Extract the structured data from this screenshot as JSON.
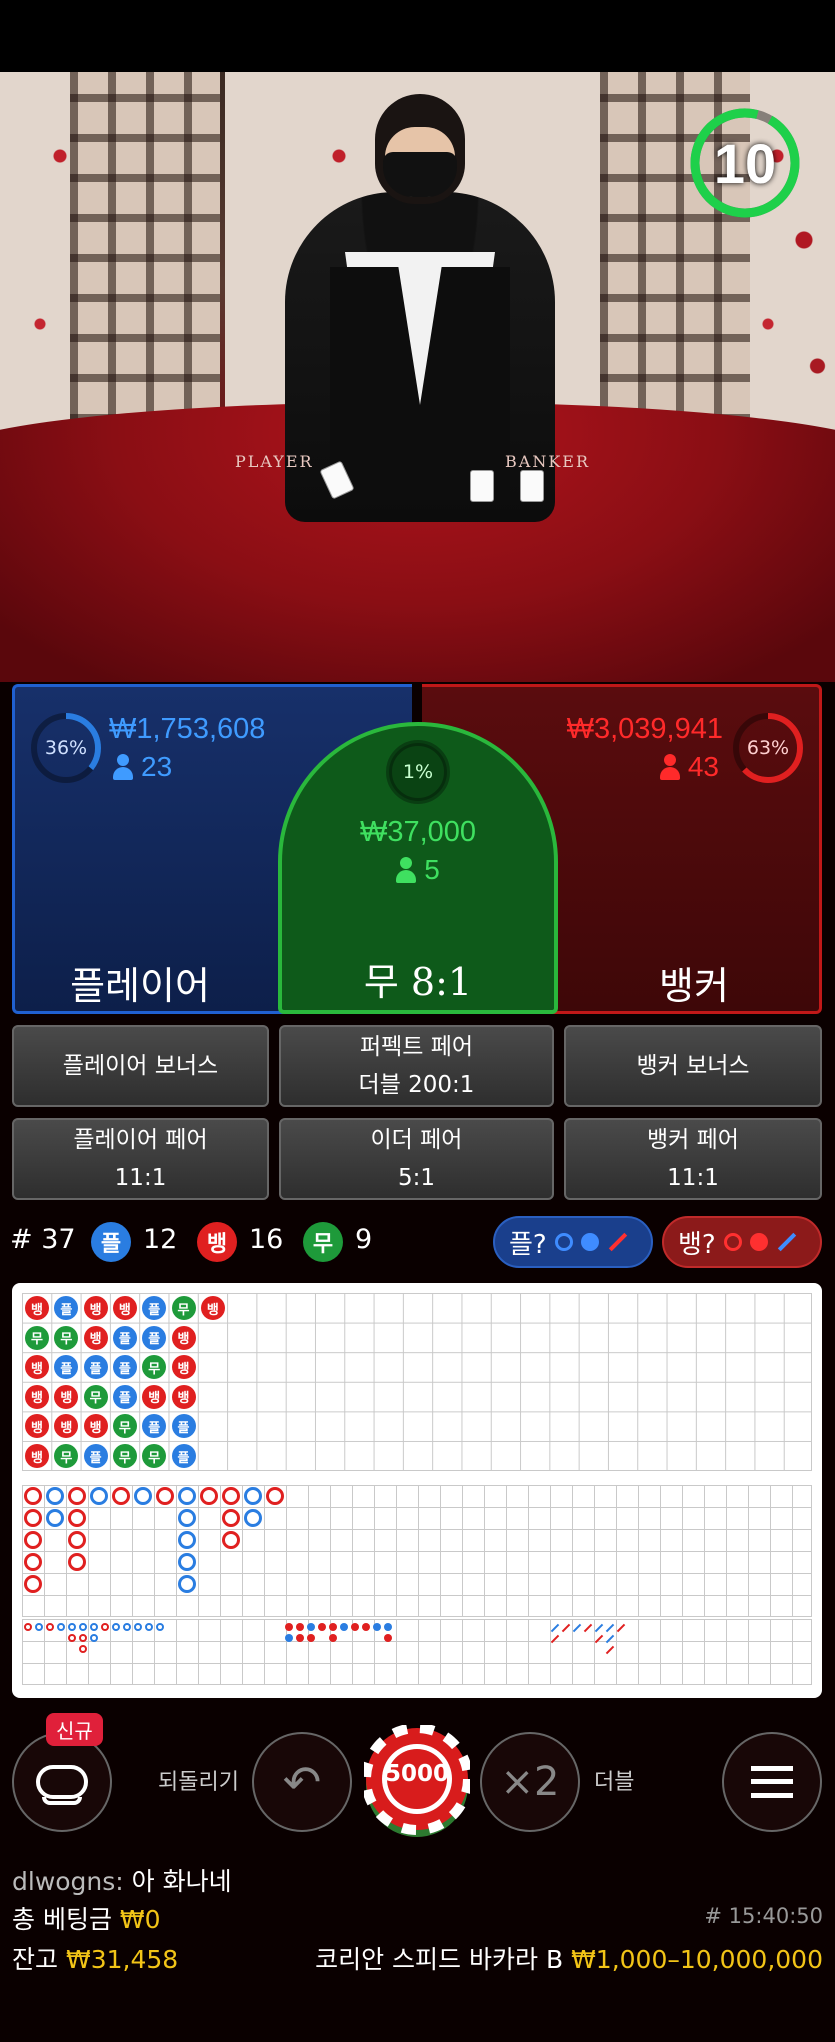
{
  "timer": {
    "value": "10"
  },
  "table_felt": {
    "player": "PLAYER",
    "banker": "BANKER"
  },
  "player": {
    "percent": "36%",
    "amount": "₩1,753,608",
    "count": "23",
    "label": "플레이어",
    "percent_value": 36
  },
  "banker": {
    "percent": "63%",
    "amount": "₩3,039,941",
    "count": "43",
    "label": "뱅커",
    "percent_value": 63
  },
  "tie": {
    "percent": "1%",
    "amount": "₩37,000",
    "count": "5",
    "label": "무 8:1"
  },
  "side_bets": [
    {
      "line1": "플레이어 보너스",
      "line2": ""
    },
    {
      "line1": "퍼펙트 페어",
      "line2": "더블 200:1"
    },
    {
      "line1": "뱅커 보너스",
      "line2": ""
    },
    {
      "line1": "플레이어 페어",
      "line2": "11:1"
    },
    {
      "line1": "이더 페어",
      "line2": "5:1"
    },
    {
      "line1": "뱅커 페어",
      "line2": "11:1"
    }
  ],
  "stats": {
    "round": "# 37",
    "player_glyph": "플",
    "player_count": "12",
    "banker_glyph": "뱅",
    "banker_count": "16",
    "tie_glyph": "무",
    "tie_count": "9",
    "player_predict": "플?",
    "banker_predict": "뱅?"
  },
  "bead_road": [
    [
      "뱅",
      "무",
      "뱅",
      "뱅",
      "뱅",
      "뱅"
    ],
    [
      "플",
      "무",
      "플",
      "뱅",
      "뱅",
      "무"
    ],
    [
      "뱅",
      "뱅",
      "플",
      "무",
      "뱅",
      "플"
    ],
    [
      "뱅",
      "플",
      "플",
      "플",
      "무",
      "무"
    ],
    [
      "플",
      "플",
      "무",
      "뱅",
      "플",
      "무"
    ],
    [
      "무",
      "뱅",
      "뱅",
      "뱅",
      "플",
      "플"
    ],
    [
      "뱅"
    ]
  ],
  "controls": {
    "new_badge": "신규",
    "undo_label": "되돌리기",
    "chip_value": "5000",
    "double_symbol": "×2",
    "double_label": "더블"
  },
  "chat": {
    "user": "dlwogns:",
    "message": "아 화나네"
  },
  "footer": {
    "total_bet_label": "총 베팅금",
    "total_bet_value": "₩0",
    "round_time": "# 15:40:50",
    "balance_label": "잔고",
    "balance_value": "₩31,458",
    "table_name": "코리안 스피드 바카라 B",
    "limits": "₩1,000–10,000,000"
  },
  "colors": {
    "player": "#2a7de1",
    "banker": "#e02020",
    "tie": "#1e9a3a",
    "gold": "#f2c417"
  }
}
